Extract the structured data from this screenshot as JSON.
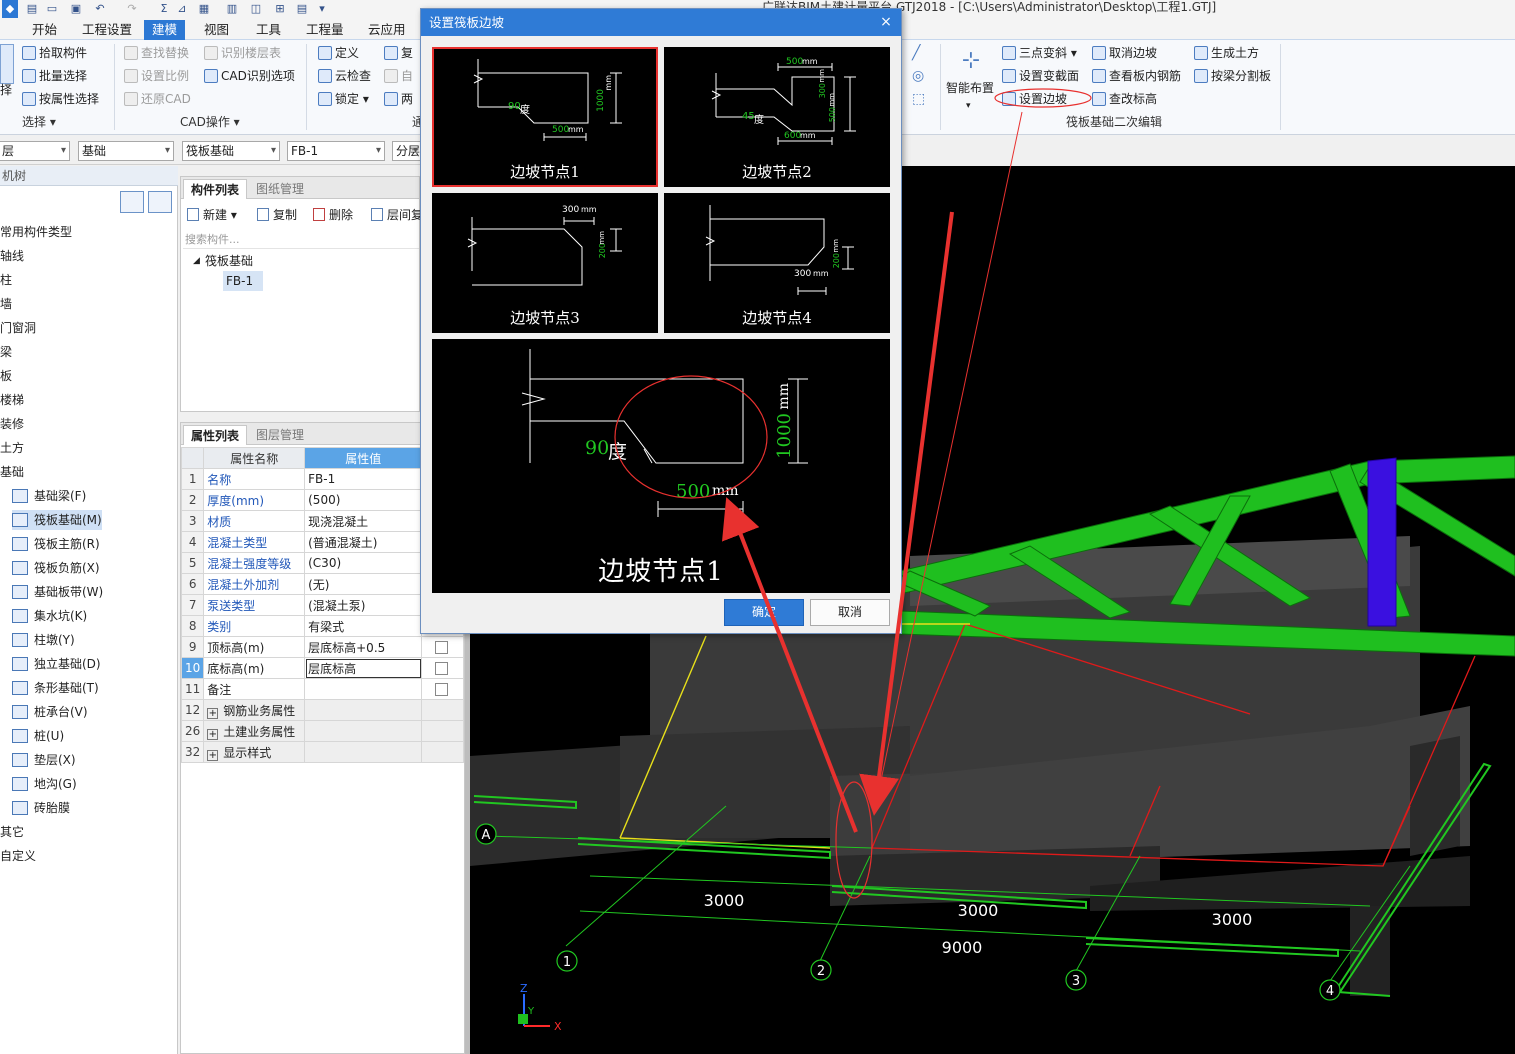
{
  "app": {
    "title": "广联达BIM土建计量平台 GTJ2018 - [C:\\Users\\Administrator\\Desktop\\工程1.GTJ]"
  },
  "menu": {
    "tabs": [
      "开始",
      "工程设置",
      "建模",
      "视图",
      "工具",
      "工程量",
      "云应用"
    ]
  },
  "ribbon": {
    "select_group": {
      "pick": "拾取构件",
      "batch": "批量选择",
      "by_attr": "按属性选择",
      "label": "选择 ▾",
      "big_partial": "择"
    },
    "cad_group": {
      "find_replace": "查找替换",
      "recognize_floor": "识别楼层表",
      "set_scale": "设置比例",
      "cad_options": "CAD识别选项",
      "restore_cad": "还原CAD",
      "label": "CAD操作 ▾"
    },
    "general_group": {
      "define": "定义",
      "copy_partial": "复",
      "cloud_check": "云检查",
      "auto_partial": "自",
      "lock": "锁定 ▾",
      "two_partial": "两",
      "label_partial": "通"
    },
    "raft_group": {
      "smart_layout": "智能布置",
      "three_point_slope": "三点变斜 ▾",
      "set_section": "设置变截面",
      "set_slope": "设置边坡",
      "cancel_slope": "取消边坡",
      "view_rebar": "查看板内钢筋",
      "change_elev": "查改标高",
      "gen_earth": "生成土方",
      "split_by_beam": "按梁分割板",
      "label": "筏板基础二次编辑"
    }
  },
  "selectors": {
    "floor_partial": "层",
    "category": "基础",
    "type": "筏板基础",
    "component": "FB-1",
    "layer_partial": "分层"
  },
  "tree": {
    "header_partial": "机树",
    "items": [
      {
        "label": "常用构件类型"
      },
      {
        "label": "轴线"
      },
      {
        "label": "柱"
      },
      {
        "label": "墙"
      },
      {
        "label": "门窗洞"
      },
      {
        "label": "梁"
      },
      {
        "label": "板"
      },
      {
        "label": "楼梯"
      },
      {
        "label": "装修"
      },
      {
        "label": "土方"
      },
      {
        "label": "基础"
      }
    ],
    "foundation_children": [
      {
        "label": "基础梁(F)"
      },
      {
        "label": "筏板基础(M)"
      },
      {
        "label": "筏板主筋(R)"
      },
      {
        "label": "筏板负筋(X)"
      },
      {
        "label": "基础板带(W)"
      },
      {
        "label": "集水坑(K)"
      },
      {
        "label": "柱墩(Y)"
      },
      {
        "label": "独立基础(D)"
      },
      {
        "label": "条形基础(T)"
      },
      {
        "label": "桩承台(V)"
      },
      {
        "label": "桩(U)"
      },
      {
        "label": "垫层(X)"
      },
      {
        "label": "地沟(G)"
      },
      {
        "label": "砖胎膜"
      }
    ],
    "tail_items": [
      {
        "label": "其它"
      },
      {
        "label": "自定义"
      }
    ]
  },
  "component_list": {
    "tabs": [
      "构件列表",
      "图纸管理"
    ],
    "buttons": {
      "new": "新建 ▾",
      "copy": "复制",
      "delete": "删除",
      "floor_copy": "层间复"
    },
    "search_placeholder": "搜索构件...",
    "group": "筏板基础",
    "selected": "FB-1"
  },
  "property_panel": {
    "tabs": [
      "属性列表",
      "图层管理"
    ],
    "headers": {
      "name": "属性名称",
      "value": "属性值"
    },
    "rows": [
      {
        "no": "1",
        "name": "名称",
        "value": "FB-1"
      },
      {
        "no": "2",
        "name": "厚度(mm)",
        "value": "(500)"
      },
      {
        "no": "3",
        "name": "材质",
        "value": "现浇混凝土"
      },
      {
        "no": "4",
        "name": "混凝土类型",
        "value": "(普通混凝土)"
      },
      {
        "no": "5",
        "name": "混凝土强度等级",
        "value": "(C30)"
      },
      {
        "no": "6",
        "name": "混凝土外加剂",
        "value": "(无)"
      },
      {
        "no": "7",
        "name": "泵送类型",
        "value": "(混凝土泵)"
      },
      {
        "no": "8",
        "name": "类别",
        "value": "有梁式"
      },
      {
        "no": "9",
        "name": "顶标高(m)",
        "value": "层底标高+0.5"
      },
      {
        "no": "10",
        "name": "底标高(m)",
        "value": "层底标高"
      },
      {
        "no": "11",
        "name": "备注",
        "value": ""
      },
      {
        "no": "12",
        "name": "钢筋业务属性",
        "value": ""
      },
      {
        "no": "26",
        "name": "土建业务属性",
        "value": ""
      },
      {
        "no": "32",
        "name": "显示样式",
        "value": ""
      }
    ]
  },
  "dialog": {
    "title": "设置筏板边坡",
    "close": "×",
    "nodes": [
      {
        "label": "边坡节点1",
        "angle": "90",
        "angle_unit": "度",
        "width": "500",
        "width_unit": "mm",
        "height": "1000",
        "height_unit": "mm"
      },
      {
        "label": "边坡节点2",
        "top": "500",
        "top_unit": "mm",
        "angle": "45",
        "angle_unit": "度",
        "bottom": "600",
        "bottom_unit": "mm",
        "h1": "300",
        "h1_unit": "mm",
        "h2": "500",
        "h2_unit": "mm"
      },
      {
        "label": "边坡节点3",
        "top": "300",
        "top_unit": "mm",
        "height": "200",
        "height_unit": "mm"
      },
      {
        "label": "边坡节点4",
        "bottom": "300",
        "bottom_unit": "mm",
        "height": "200",
        "height_unit": "mm"
      }
    ],
    "preview": {
      "label": "边坡节点1",
      "angle": "90",
      "angle_unit": "度",
      "width": "500",
      "width_unit": "mm",
      "height": "1000",
      "height_unit": "mm"
    },
    "ok": "确定",
    "cancel": "取消"
  },
  "viewport": {
    "dims": {
      "d1": "3000",
      "d2": "3000",
      "d3": "3000",
      "total": "9000"
    },
    "axes": {
      "a": "A",
      "n1": "1",
      "n2": "2",
      "n3": "3",
      "n4": "4"
    },
    "gizmo": {
      "x": "X",
      "y": "Y",
      "z": "Z"
    }
  },
  "colors": {
    "accent": "#2c78d4",
    "highlight_red": "#e8312f",
    "beam_green": "#1fbf1f",
    "column_blue": "#3a10e0",
    "dim_green": "#21c721"
  }
}
